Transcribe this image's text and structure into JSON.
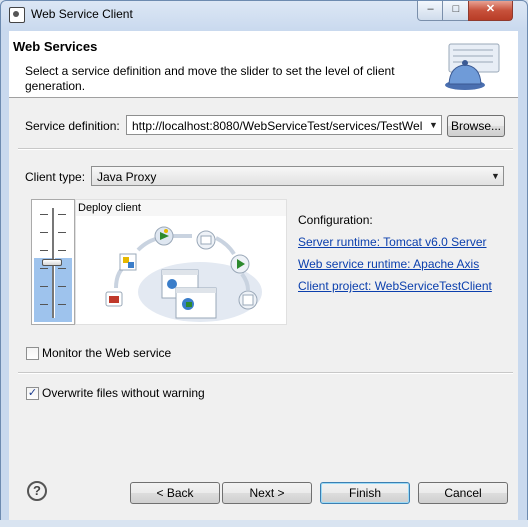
{
  "window": {
    "title": "Web Service Client",
    "controls": {
      "minimize": "–",
      "maximize": "□",
      "close": "✕"
    }
  },
  "banner": {
    "title": "Web Services",
    "description": "Select a service definition and move the slider to set the level of client generation.",
    "icon": "service-bell-icon"
  },
  "service_definition": {
    "label": "Service definition:",
    "value": "http://localhost:8080/WebServiceTest/services/TestWel",
    "browse_label": "Browse..."
  },
  "client_type": {
    "label": "Client type:",
    "value": "Java Proxy"
  },
  "slider": {
    "label": "Deploy client",
    "level": 0.5
  },
  "configuration": {
    "heading": "Configuration:",
    "links": [
      "Server runtime: Tomcat v6.0 Server",
      "Web service runtime: Apache Axis",
      "Client project: WebServiceTestClient"
    ]
  },
  "options": {
    "monitor": {
      "label": "Monitor the Web service",
      "checked": false,
      "mark": ""
    },
    "overwrite": {
      "label": "Overwrite files without warning",
      "checked": true,
      "mark": "✓"
    }
  },
  "buttons": {
    "help": "?",
    "back": "< Back",
    "next": "Next >",
    "finish": "Finish",
    "cancel": "Cancel"
  },
  "colors": {
    "link": "#0b3fad",
    "slider_fill": "#9ec3ed",
    "default_button_border": "#3c7fb1"
  }
}
